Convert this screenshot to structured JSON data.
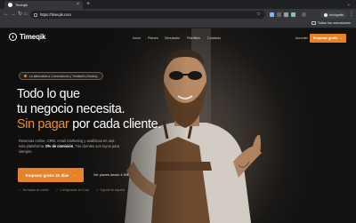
{
  "browser": {
    "tab": {
      "title": "Timeqik"
    },
    "address": {
      "url": "https://timeqik.com"
    },
    "profile_label": "Incógnito",
    "bookmarks": {
      "label": "Todos los marcadores"
    }
  },
  "site": {
    "brand": "Timeqik",
    "nav": [
      "Inicio",
      "Planes",
      "Simulador",
      "Plantillas",
      "Contacto"
    ],
    "login_label": "Acceder",
    "top_cta_label": "Empezar gratis",
    "top_cta_arrow": "→"
  },
  "hero": {
    "notice": "La alternativa a Commissions y Treatwell o Booksy",
    "headline_line1": "Todo lo que",
    "headline_line2": "tu negocio necesita.",
    "headline_accent": "Sin pagar",
    "headline_rest": " por cada cliente.",
    "sub_line1": "Reservas online, CRM, email marketing y analíticas en una",
    "sub_line2_prefix": "sola plataforma. ",
    "sub_line2_bold": "0% de comisión",
    "sub_line2_suffix": ". Tus clientes son tuyos para",
    "sub_line3": "siempre.",
    "cta_label": "Empezar gratis 30 días",
    "cta_arrow": "→",
    "price_link": "Ver planes desde 4.90€",
    "features": [
      "Sin tarjeta de crédito",
      "Configuración en 5 min",
      "Soporte en español"
    ]
  },
  "colors": {
    "accent": "#e8822a",
    "accent_text": "#f0902f",
    "browser_bg": "#202124",
    "toolbar_bg": "#35363a"
  },
  "icons": [
    "favicon-icon",
    "close-icon",
    "plus-icon",
    "back-icon",
    "forward-icon",
    "reload-icon",
    "home-icon",
    "lock-icon",
    "star-icon",
    "incognito-icon",
    "menu-icon",
    "folder-icon",
    "check-icon",
    "arrow-right-icon"
  ]
}
